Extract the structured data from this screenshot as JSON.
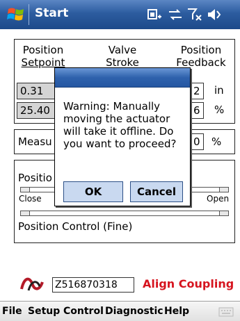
{
  "titlebar": {
    "title": "Start",
    "icons": [
      "windows-start-icon",
      "battery-icon",
      "connectivity-icon",
      "no-signal-icon",
      "volume-icon"
    ]
  },
  "headers": {
    "setpoint": [
      "Position",
      "Setpoint"
    ],
    "stroke": [
      "Valve",
      "Stroke"
    ],
    "feedback": [
      "Position",
      "Feedback"
    ]
  },
  "values": {
    "setpoint_in": "0.31",
    "setpoint_pct": "25.40",
    "feedback_in": "2",
    "feedback_pct": "6",
    "unit_in": "in",
    "unit_pct": "%"
  },
  "measured": {
    "label": "Measu",
    "value": "0",
    "unit": "%"
  },
  "position_control": {
    "label": "Positio",
    "close_label": "Close",
    "open_label": "Open",
    "fine_label": "Position Control (Fine)"
  },
  "dialog": {
    "message": "Warning: Manually moving the actuator will take it offline. Do you want to proceed?",
    "ok_label": "OK",
    "cancel_label": "Cancel"
  },
  "footer": {
    "device_id": "Z516870318",
    "action_label": "Align Coupling"
  },
  "menu": {
    "items": [
      "File",
      "Setup",
      "Control",
      "Diagnostic",
      "Help"
    ]
  },
  "colors": {
    "titlebar": "#2c5c9f",
    "accent_red": "#d6141f",
    "dialog_button": "#c9d9f0"
  }
}
